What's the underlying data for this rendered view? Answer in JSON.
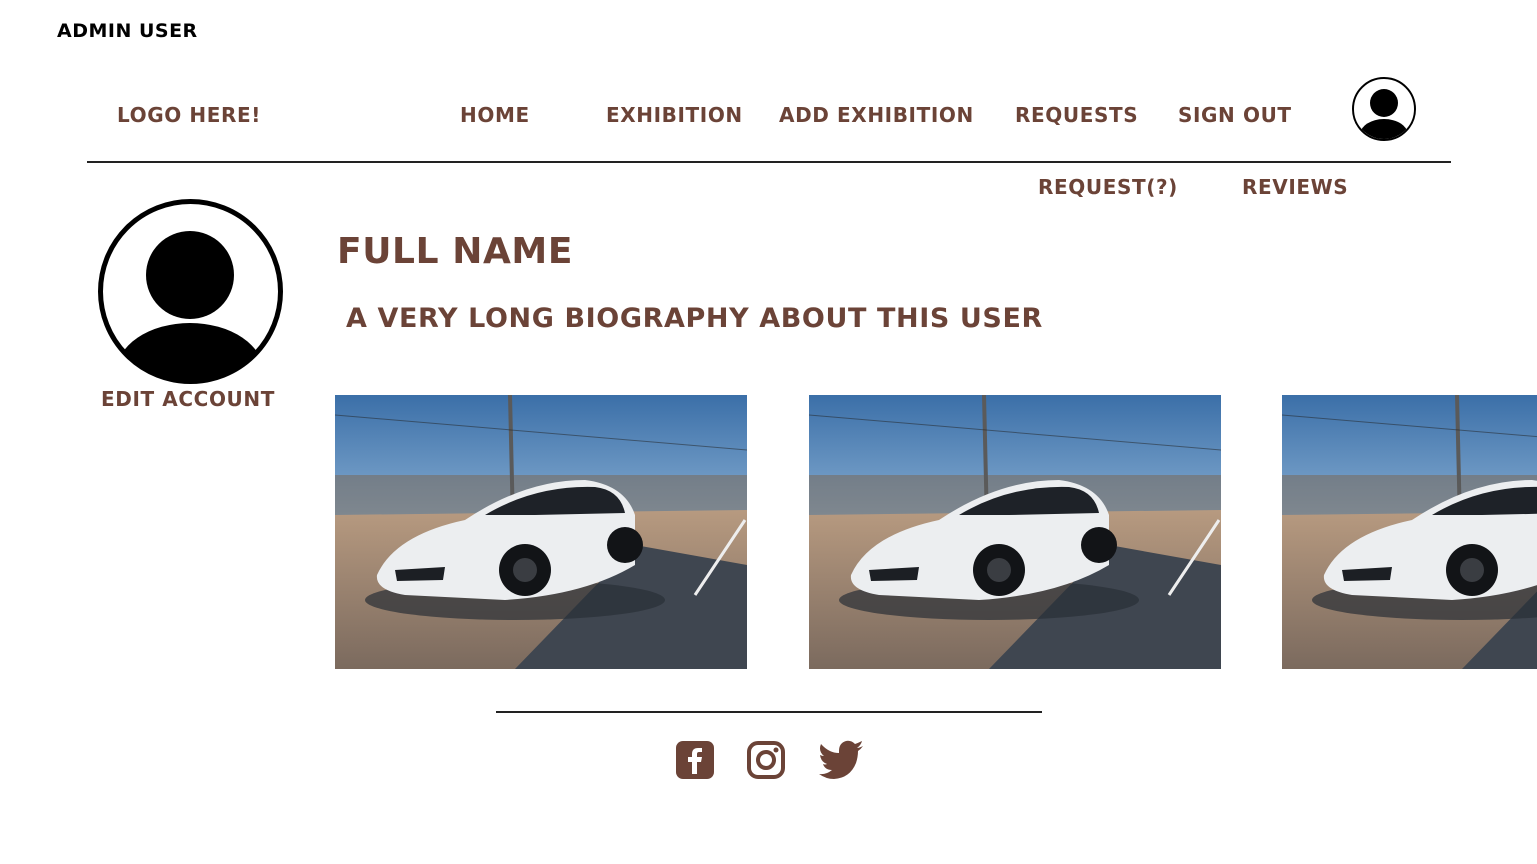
{
  "top_label": "ADMIN USER",
  "nav": {
    "logo": "LOGO HERE!",
    "home": "HOME",
    "exhibition": "EXHIBITION",
    "add_exhibition": "ADD EXHIBITION",
    "requests": "REQUESTS",
    "sign_out": "SIGN OUT",
    "avatar_icon": "user-avatar-icon"
  },
  "subnav": {
    "request": "REQUEST(?)",
    "reviews": "REVIEWS"
  },
  "profile": {
    "avatar_icon": "user-avatar-icon",
    "edit_account": "EDIT ACCOUNT",
    "full_name": "FULL NAME",
    "biography": "A VERY LONG BIOGRAPHY ABOUT THIS USER"
  },
  "gallery": {
    "images": [
      "white-car-photo",
      "white-car-photo",
      "white-car-photo"
    ]
  },
  "footer": {
    "social_icons": [
      "facebook-icon",
      "instagram-icon",
      "twitter-icon"
    ]
  },
  "colors": {
    "accent": "#6b4337",
    "text": "#000000",
    "background": "#ffffff"
  }
}
